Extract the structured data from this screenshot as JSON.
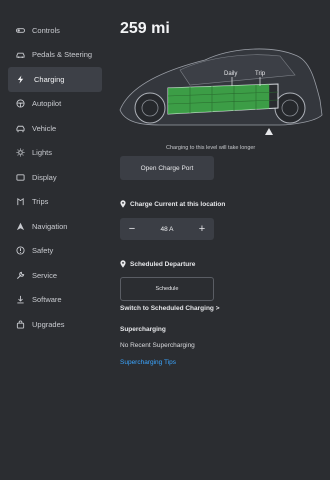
{
  "sidebar": {
    "items": [
      {
        "label": "Controls",
        "icon": "toggle-icon"
      },
      {
        "label": "Pedals & Steering",
        "icon": "car-icon"
      },
      {
        "label": "Charging",
        "icon": "bolt-icon",
        "active": true
      },
      {
        "label": "Autopilot",
        "icon": "steering-wheel-icon"
      },
      {
        "label": "Vehicle",
        "icon": "vehicle-icon"
      },
      {
        "label": "Lights",
        "icon": "sun-icon"
      },
      {
        "label": "Display",
        "icon": "display-icon"
      },
      {
        "label": "Trips",
        "icon": "trips-icon"
      },
      {
        "label": "Navigation",
        "icon": "navigation-arrow-icon"
      },
      {
        "label": "Safety",
        "icon": "safety-icon"
      },
      {
        "label": "Service",
        "icon": "wrench-icon"
      },
      {
        "label": "Software",
        "icon": "download-icon"
      },
      {
        "label": "Upgrades",
        "icon": "bag-icon"
      }
    ]
  },
  "main": {
    "range": "259 mi",
    "battery": {
      "daily_label": "Daily",
      "trip_label": "Trip",
      "charge_level": 0.92,
      "color": "#3fb24a"
    },
    "charge_note": "Charging to this level will take longer",
    "charge_port_button": "Open Charge Port",
    "charge_current": {
      "title": "Charge Current at this location",
      "value": "48 A",
      "minus": "−",
      "plus": "+"
    },
    "scheduled_departure": {
      "title": "Scheduled Departure",
      "button": "Schedule",
      "link": "Switch to Scheduled Charging >"
    },
    "supercharging": {
      "title": "Supercharging",
      "status": "No Recent Supercharging",
      "tips": "Supercharging Tips",
      "link_color": "#3aa5ff"
    }
  }
}
